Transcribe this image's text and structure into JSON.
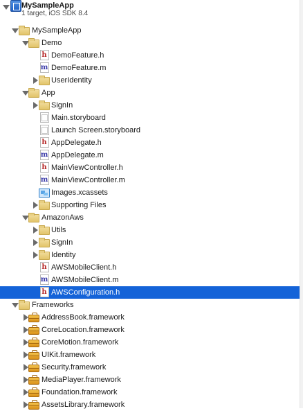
{
  "project": {
    "name": "MySampleApp",
    "subtitle": "1 target, iOS SDK 8.4",
    "icon": "xcode-project-icon"
  },
  "tree": [
    {
      "label": "MySampleApp",
      "kind": "group",
      "disclosure": "expanded",
      "depth": 1,
      "icon": "folder-icon"
    },
    {
      "label": "Demo",
      "kind": "group",
      "disclosure": "expanded",
      "depth": 2,
      "icon": "folder-icon"
    },
    {
      "label": "DemoFeature.h",
      "kind": "header",
      "disclosure": "none",
      "depth": 3,
      "icon": "header-file-icon",
      "glyph": "h"
    },
    {
      "label": "DemoFeature.m",
      "kind": "impl",
      "disclosure": "none",
      "depth": 3,
      "icon": "implementation-file-icon",
      "glyph": "m"
    },
    {
      "label": "UserIdentity",
      "kind": "group",
      "disclosure": "collapsed",
      "depth": 3,
      "icon": "folder-icon"
    },
    {
      "label": "App",
      "kind": "group",
      "disclosure": "expanded",
      "depth": 2,
      "icon": "folder-icon"
    },
    {
      "label": "SignIn",
      "kind": "group",
      "disclosure": "collapsed",
      "depth": 3,
      "icon": "folder-icon"
    },
    {
      "label": "Main.storyboard",
      "kind": "storyboard",
      "disclosure": "none",
      "depth": 3,
      "icon": "storyboard-file-icon"
    },
    {
      "label": "Launch Screen.storyboard",
      "kind": "storyboard",
      "disclosure": "none",
      "depth": 3,
      "icon": "storyboard-file-icon"
    },
    {
      "label": "AppDelegate.h",
      "kind": "header",
      "disclosure": "none",
      "depth": 3,
      "icon": "header-file-icon",
      "glyph": "h"
    },
    {
      "label": "AppDelegate.m",
      "kind": "impl",
      "disclosure": "none",
      "depth": 3,
      "icon": "implementation-file-icon",
      "glyph": "m"
    },
    {
      "label": "MainViewController.h",
      "kind": "header",
      "disclosure": "none",
      "depth": 3,
      "icon": "header-file-icon",
      "glyph": "h"
    },
    {
      "label": "MainViewController.m",
      "kind": "impl",
      "disclosure": "none",
      "depth": 3,
      "icon": "implementation-file-icon",
      "glyph": "m"
    },
    {
      "label": "Images.xcassets",
      "kind": "assets",
      "disclosure": "none",
      "depth": 3,
      "icon": "asset-catalog-icon"
    },
    {
      "label": "Supporting Files",
      "kind": "group",
      "disclosure": "collapsed",
      "depth": 3,
      "icon": "folder-icon"
    },
    {
      "label": "AmazonAws",
      "kind": "group",
      "disclosure": "expanded",
      "depth": 2,
      "icon": "folder-icon"
    },
    {
      "label": "Utils",
      "kind": "group",
      "disclosure": "collapsed",
      "depth": 3,
      "icon": "folder-icon"
    },
    {
      "label": "SignIn",
      "kind": "group",
      "disclosure": "collapsed",
      "depth": 3,
      "icon": "folder-icon"
    },
    {
      "label": "Identity",
      "kind": "group",
      "disclosure": "collapsed",
      "depth": 3,
      "icon": "folder-icon"
    },
    {
      "label": "AWSMobileClient.h",
      "kind": "header",
      "disclosure": "none",
      "depth": 3,
      "icon": "header-file-icon",
      "glyph": "h"
    },
    {
      "label": "AWSMobileClient.m",
      "kind": "impl",
      "disclosure": "none",
      "depth": 3,
      "icon": "implementation-file-icon",
      "glyph": "m"
    },
    {
      "label": "AWSConfiguration.h",
      "kind": "header",
      "disclosure": "none",
      "depth": 3,
      "icon": "header-file-icon",
      "glyph": "h",
      "selected": true
    },
    {
      "label": "Frameworks",
      "kind": "group",
      "disclosure": "expanded",
      "depth": 1,
      "icon": "folder-icon"
    },
    {
      "label": "AddressBook.framework",
      "kind": "framework",
      "disclosure": "collapsed",
      "depth": 2,
      "icon": "framework-toolbox-icon"
    },
    {
      "label": "CoreLocation.framework",
      "kind": "framework",
      "disclosure": "collapsed",
      "depth": 2,
      "icon": "framework-toolbox-icon"
    },
    {
      "label": "CoreMotion.framework",
      "kind": "framework",
      "disclosure": "collapsed",
      "depth": 2,
      "icon": "framework-toolbox-icon"
    },
    {
      "label": "UIKit.framework",
      "kind": "framework",
      "disclosure": "collapsed",
      "depth": 2,
      "icon": "framework-toolbox-icon"
    },
    {
      "label": "Security.framework",
      "kind": "framework",
      "disclosure": "collapsed",
      "depth": 2,
      "icon": "framework-toolbox-icon"
    },
    {
      "label": "MediaPlayer.framework",
      "kind": "framework",
      "disclosure": "collapsed",
      "depth": 2,
      "icon": "framework-toolbox-icon"
    },
    {
      "label": "Foundation.framework",
      "kind": "framework",
      "disclosure": "collapsed",
      "depth": 2,
      "icon": "framework-toolbox-icon"
    },
    {
      "label": "AssetsLibrary.framework",
      "kind": "framework",
      "disclosure": "collapsed",
      "depth": 2,
      "icon": "framework-toolbox-icon"
    }
  ],
  "colors": {
    "selection": "#1463d8",
    "header_glyph": "#b72b2b",
    "impl_glyph": "#3a3aa8",
    "folder": "#e2c46a",
    "disclosure": "#6a6a6a"
  }
}
